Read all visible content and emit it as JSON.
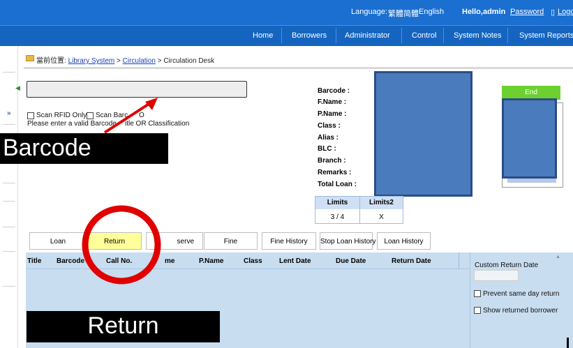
{
  "topbar": {
    "language_label": "Language:",
    "languages": [
      "繁體",
      "简體",
      "English"
    ],
    "greeting": "Hello,admin",
    "password_link": "Password",
    "logout_link": "Logo"
  },
  "nav": {
    "items": [
      "Home",
      "Borrowers",
      "Administrator",
      "Control",
      "System Notes",
      "System Reports"
    ]
  },
  "breadcrumb": {
    "prefix": "當前位置:",
    "level1": "Library System",
    "level2": "Circulation",
    "current": "Circulation Desk",
    "sep": ">"
  },
  "scan": {
    "input_value": "",
    "rfid_label": "Scan RFID Only",
    "barcode_label": "Scan Barc",
    "barcode_label_tail": "O",
    "hint": "Please enter a valid Barcode",
    "hint_tail": "itle OR Classification"
  },
  "info_labels": [
    "Barcode :",
    "F.Name :",
    "P.Name :",
    "Class :",
    "Alias :",
    "BLC :",
    "Branch :",
    "Remarks :",
    "Total Loan :"
  ],
  "end_button": "End",
  "limits": {
    "headers": [
      "Limits",
      "Limits2"
    ],
    "values": [
      "3 / 4",
      "X"
    ]
  },
  "tabs": [
    "Loan",
    "Return",
    "serve",
    "Fine",
    "Fine History",
    "Stop Loan History",
    "Loan History"
  ],
  "grid": {
    "columns": [
      "Title",
      "Barcode",
      "Call No.",
      "me",
      "P.Name",
      "Class",
      "Lent Date",
      "Due Date",
      "Return Date"
    ]
  },
  "options": {
    "custom_return_date": "Custom Return Date",
    "prevent_same_day": "Prevent same day return",
    "show_returned": "Show returned borrower"
  },
  "annotations": {
    "barcode": "Barcode",
    "return": "Return",
    "highlight_color": "#e00000",
    "return_tab_color": "#ffff99"
  }
}
